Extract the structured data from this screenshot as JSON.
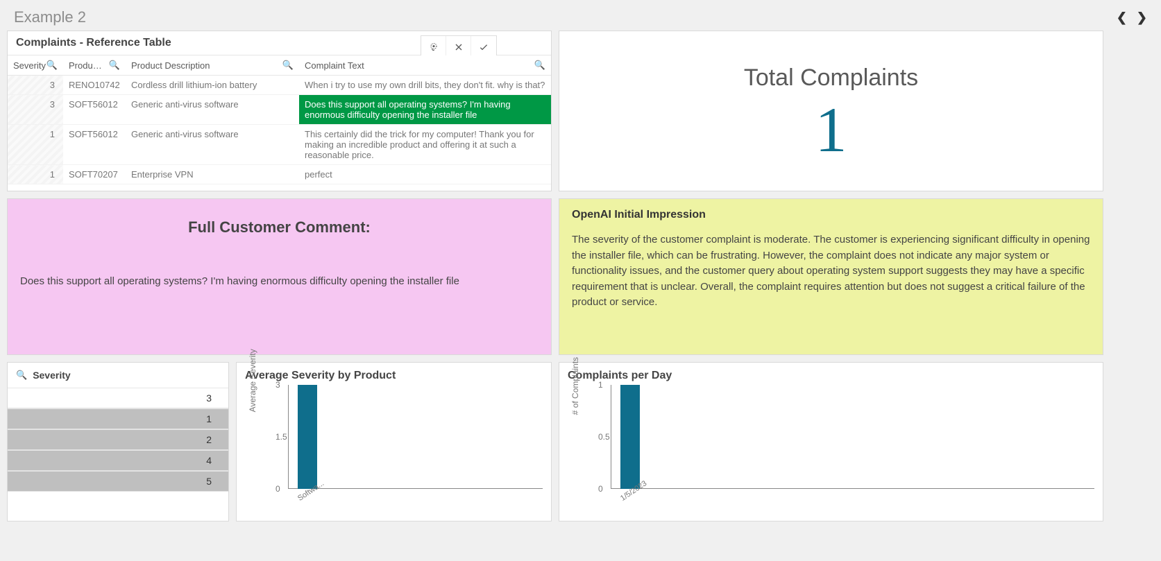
{
  "header": {
    "title": "Example 2"
  },
  "table": {
    "title": "Complaints - Reference Table",
    "columns": {
      "severity": "Severity",
      "product": "Produ…",
      "description": "Product Description",
      "complaint": "Complaint Text"
    },
    "rows": [
      {
        "severity": "3",
        "product": "RENO10742",
        "description": "Cordless drill lithium-ion battery",
        "complaint": "When i try to use my own drill bits, they don't fit. why is that?",
        "selected": false
      },
      {
        "severity": "3",
        "product": "SOFT56012",
        "description": "Generic anti-virus software",
        "complaint": "Does this support all operating systems? I'm having enormous difficulty opening the installer file",
        "selected": true
      },
      {
        "severity": "1",
        "product": "SOFT56012",
        "description": "Generic anti-virus software",
        "complaint": "This certainly did the trick for my computer! Thank you for making an incredible product and offering it at such a reasonable price.",
        "selected": false
      },
      {
        "severity": "1",
        "product": "SOFT70207",
        "description": "Enterprise VPN",
        "complaint": "perfect",
        "selected": false
      }
    ]
  },
  "kpi": {
    "title": "Total Complaints",
    "value": "1"
  },
  "comment": {
    "title": "Full Customer Comment:",
    "body": "Does this support all operating systems? I'm having enormous difficulty opening the installer file"
  },
  "impression": {
    "title": "OpenAI Initial Impression",
    "body": "The severity of the customer complaint is moderate. The customer is experiencing significant difficulty in opening the installer file, which can be frustrating. However, the complaint does not indicate any major system or functionality issues, and the customer query about operating system support suggests they may have a specific requirement that is unclear. Overall, the complaint requires attention but does not suggest a critical failure of the product or service."
  },
  "filter": {
    "label": "Severity",
    "items": [
      {
        "value": "3",
        "selected": false
      },
      {
        "value": "1",
        "selected": true
      },
      {
        "value": "2",
        "selected": true
      },
      {
        "value": "4",
        "selected": true
      },
      {
        "value": "5",
        "selected": true
      }
    ]
  },
  "chart_data": [
    {
      "id": "avg_severity",
      "type": "bar",
      "title": "Average Severity by Product",
      "ylabel": "Average Severity",
      "categories": [
        "Softwa..."
      ],
      "values": [
        3
      ],
      "ylim": [
        0,
        3
      ],
      "ticks": [
        0,
        1.5,
        3
      ],
      "color": "#0f6e8c"
    },
    {
      "id": "complaints_per_day",
      "type": "bar",
      "title": "Complaints per Day",
      "ylabel": "# of Complaints",
      "categories": [
        "1/5/2023"
      ],
      "values": [
        1
      ],
      "ylim": [
        0,
        1
      ],
      "ticks": [
        0,
        0.5,
        1
      ],
      "color": "#0f6e8c"
    }
  ]
}
